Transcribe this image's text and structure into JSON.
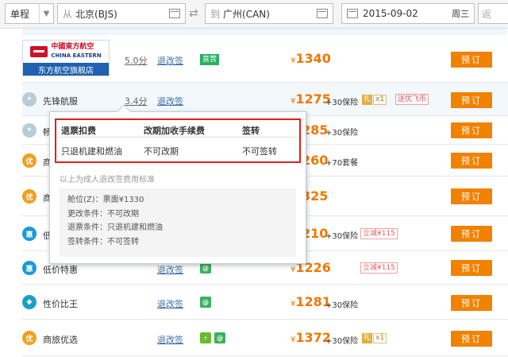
{
  "search": {
    "trip_type": "单程",
    "from_prefix": "从",
    "from_city": "北京(BJS)",
    "to_prefix": "到",
    "to_city": "广州(CAN)",
    "date": "2015-09-02",
    "weekday": "周三",
    "return_placeholder": "返"
  },
  "rows": [
    {
      "name": "东方航空旗舰店",
      "logo_cn": "中國東方航空",
      "logo_en": "CHINA EASTERN",
      "score": "5.0分",
      "refund": "退改签",
      "badge": "直营",
      "price": "1340",
      "yen": "¥",
      "button": "预订"
    },
    {
      "name": "先锋航服",
      "score": "3.4分",
      "refund": "退改签",
      "price": "1275",
      "yen": "¥",
      "extra": "+30保险",
      "gift": "礼",
      "gift_count": "x1",
      "tag": "送优飞币",
      "button": "预订"
    },
    {
      "name": "畅",
      "price": "285",
      "extra": "+30保险",
      "button": "预订"
    },
    {
      "name": "商",
      "icon": "优",
      "price": "260",
      "extra": "+70套餐",
      "button": "预订"
    },
    {
      "name": "商",
      "icon": "优",
      "price": "325",
      "button": "预订"
    },
    {
      "name": "低",
      "icon": "惠",
      "price": "210",
      "extra": "+30保险",
      "tag": "立减¥115",
      "button": "预订"
    },
    {
      "name": "低价特惠",
      "icon": "惠",
      "refund": "退改签",
      "price": "1226",
      "yen": "¥",
      "tag": "立减¥115",
      "button": "预订"
    },
    {
      "name": "性价比王",
      "refund": "退改签",
      "price": "1281",
      "yen": "¥",
      "extra": "+30保险",
      "button": "预订"
    },
    {
      "name": "商旅优选",
      "icon": "优",
      "refund": "退改签",
      "price": "1372",
      "yen": "¥",
      "extra": "+30保险",
      "gift": "礼",
      "gift_count": "x1",
      "button": "预订"
    }
  ],
  "popover": {
    "headers": [
      "退票扣费",
      "改期加收手续费",
      "签转"
    ],
    "values": [
      "只退机建和燃油",
      "不可改期",
      "不可签转"
    ],
    "note": "以上为成人退改签费用标准",
    "details": [
      "舱位(Z)：票面¥1330",
      "更改条件：不可改期",
      "退票条件：只退机建和燃油",
      "签转条件：不可签转"
    ]
  },
  "colors": {
    "accent": "#f08200",
    "price": "#f07800",
    "highlight": "#e02020",
    "brand_bar": "#1e62b0"
  }
}
